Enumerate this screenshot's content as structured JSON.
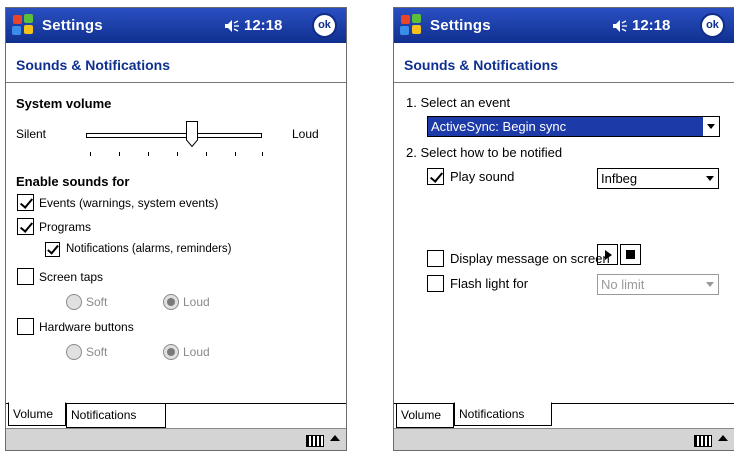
{
  "left": {
    "title": "Settings",
    "time": "12:18",
    "ok_label": "ok",
    "heading": "Sounds & Notifications",
    "system_volume": "System volume",
    "silent": "Silent",
    "loud": "Loud",
    "volume_level": 0.6,
    "enable_sounds_for": "Enable sounds for",
    "events": "Events (warnings, system events)",
    "programs": "Programs",
    "notifications": "Notifications (alarms, reminders)",
    "screen_taps": "Screen taps",
    "hardware_buttons": "Hardware buttons",
    "soft": "Soft",
    "radio_loud": "Loud",
    "tabs": [
      "Volume",
      "Notifications"
    ],
    "active_tab": "Volume"
  },
  "right": {
    "title": "Settings",
    "time": "12:18",
    "ok_label": "ok",
    "heading": "Sounds & Notifications",
    "step1": "1. Select an event",
    "event_value": "ActiveSync: Begin sync",
    "step2": "2. Select how to be notified",
    "play_sound": "Play sound",
    "sound_value": "Infbeg",
    "display_message": "Display message on screen",
    "flash_light": "Flash light for",
    "flash_value": "No limit",
    "tabs": [
      "Volume",
      "Notifications"
    ],
    "active_tab": "Notifications"
  },
  "colors": {
    "titlebar": "#1739a8",
    "heading": "#10308f",
    "selection": "#1c3aa8"
  },
  "icons": [
    "start-menu-icon",
    "speaker-icon",
    "ok-button",
    "keyboard-icon",
    "sip-arrow-icon",
    "play-icon",
    "stop-icon"
  ]
}
